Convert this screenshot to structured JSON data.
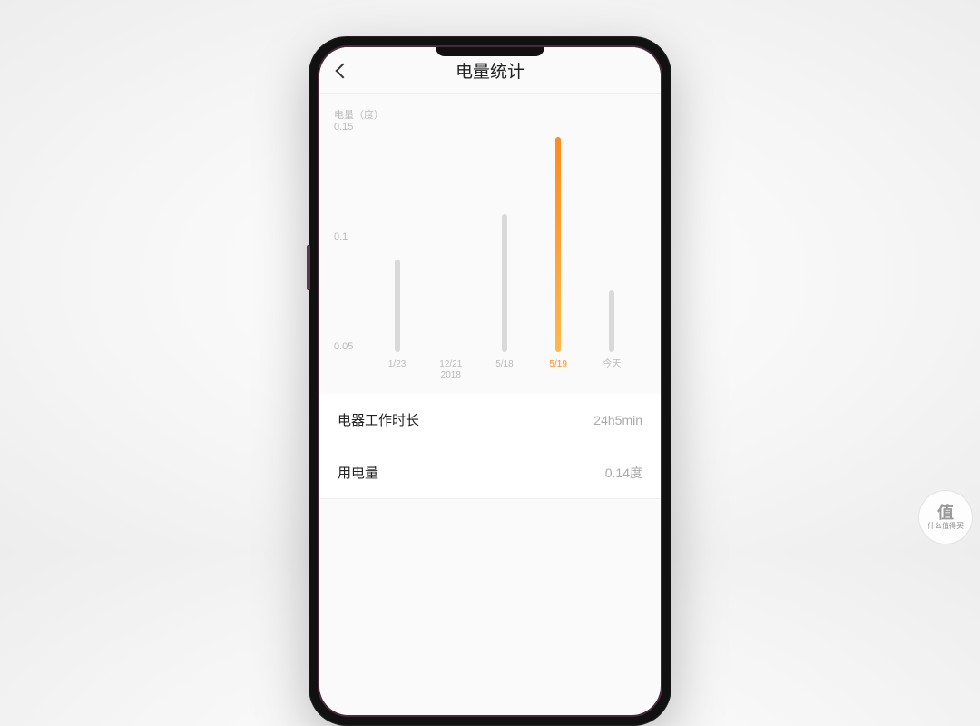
{
  "header": {
    "title": "电量统计"
  },
  "chart_data": {
    "type": "bar",
    "unit_label": "电量（度）",
    "y_ticks": [
      "0.15",
      "0.1",
      "0.05"
    ],
    "ylim": [
      0,
      0.15
    ],
    "categories": [
      "1/23",
      "12/21\n2018",
      "5/18",
      "5/19",
      "今天"
    ],
    "values": [
      0.06,
      0.0,
      0.09,
      0.14,
      0.04
    ],
    "highlighted_index": 3
  },
  "stats": {
    "work_duration_label": "电器工作时长",
    "work_duration_value": "24h5min",
    "usage_label": "用电量",
    "usage_value": "0.14度"
  },
  "badge": {
    "glyph": "值",
    "text": "什么值得买"
  }
}
